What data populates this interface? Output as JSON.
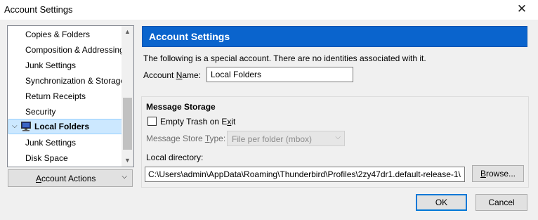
{
  "window": {
    "title": "Account Settings",
    "close_glyph": "✕"
  },
  "tree": {
    "items": [
      {
        "label": "Copies & Folders"
      },
      {
        "label": "Composition & Addressing"
      },
      {
        "label": "Junk Settings"
      },
      {
        "label": "Synchronization & Storage"
      },
      {
        "label": "Return Receipts"
      },
      {
        "label": "Security"
      },
      {
        "label": "Local Folders",
        "selected": true,
        "icon": "computer-icon",
        "expanded": true
      },
      {
        "label": "Junk Settings"
      },
      {
        "label": "Disk Space"
      }
    ],
    "twisty_glyph": "✔"
  },
  "account_actions": {
    "label_pre": "",
    "label_key": "A",
    "label_post": "ccount Actions",
    "chevron": "⌄"
  },
  "panel": {
    "header": "Account Settings",
    "info": "The following is a special account. There are no identities associated with it.",
    "account_name_label_pre": "Account ",
    "account_name_label_key": "N",
    "account_name_label_post": "ame:",
    "account_name_value": "Local Folders"
  },
  "storage": {
    "title": "Message Storage",
    "empty_trash_pre": "Empty Trash on E",
    "empty_trash_key": "x",
    "empty_trash_post": "it",
    "empty_trash_checked": false,
    "store_type_pre": "Message Store ",
    "store_type_key": "T",
    "store_type_post": "ype:",
    "store_type_value": "File per folder (mbox)",
    "local_dir_label": "Local directory:",
    "local_dir_value": "C:\\Users\\admin\\AppData\\Roaming\\Thunderbird\\Profiles\\2zy47dr1.default-release-1\\",
    "browse_pre": "",
    "browse_key": "B",
    "browse_post": "rowse..."
  },
  "buttons": {
    "ok": "OK",
    "cancel": "Cancel"
  }
}
